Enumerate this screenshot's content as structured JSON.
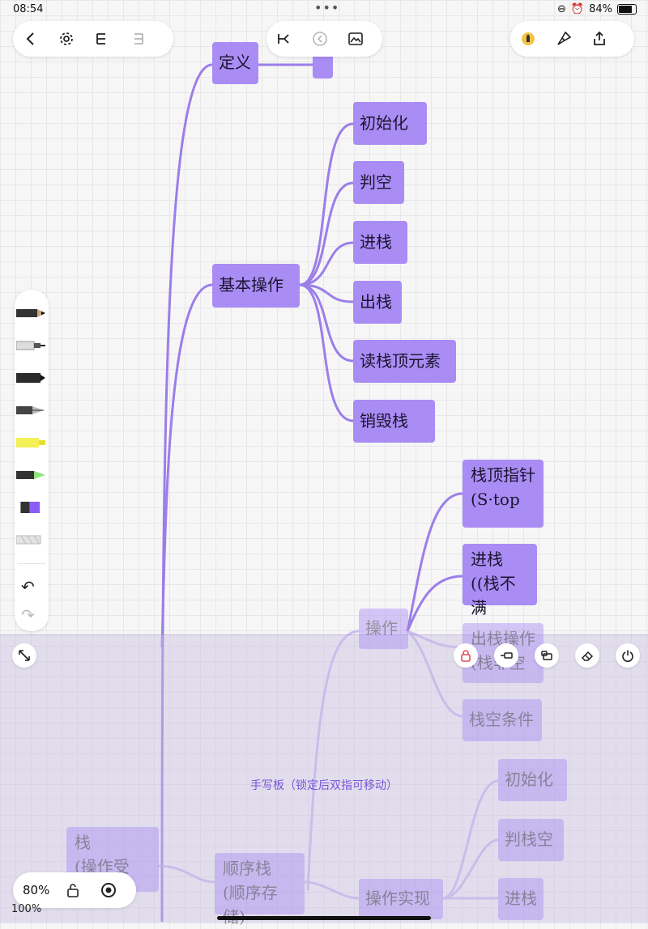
{
  "status": {
    "time": "08:54",
    "battery": "84%"
  },
  "toolbar": {
    "left_icons": [
      "back-icon",
      "settings-icon",
      "undo-layout-icon",
      "redo-layout-icon"
    ],
    "center_icons": [
      "branch-icon",
      "collapse-icon",
      "image-icon"
    ],
    "right_icons": [
      "pen-color-icon",
      "paint-brush-icon",
      "share-icon"
    ]
  },
  "mindmap": {
    "def": "定义",
    "basic_ops": "基本操作",
    "ops": [
      "初始化",
      "判空",
      "进栈",
      "出栈",
      "读栈顶元素",
      "销毁栈"
    ],
    "op_node": "操作",
    "top_ptr": [
      "栈顶指针",
      "(S·top"
    ],
    "push": [
      "进栈",
      "((栈不满"
    ],
    "pop": [
      "出栈操作",
      "(栈非空"
    ],
    "empty_cond": "栈空条件",
    "stack": [
      "栈",
      "(操作受限)"
    ],
    "seq_stack": [
      "顺序栈",
      "(顺序存储)"
    ],
    "impl": "操作实现",
    "impl_children": [
      "初始化",
      "判栈空",
      "进栈"
    ]
  },
  "tools": [
    "pencil",
    "fineliner",
    "marker",
    "fountain-pen",
    "highlighter",
    "brush",
    "eraser",
    "lasso"
  ],
  "panel": {
    "label": "手写板（锁定后双指可移动）",
    "buttons": [
      "lock-icon",
      "cursor-icon",
      "resize-icon",
      "eraser-icon",
      "power-icon"
    ]
  },
  "zoom": {
    "value": "80%",
    "base": "100%"
  },
  "colors": {
    "node": "#a98cf4",
    "edge": "#9b7ee8",
    "accent": "#7a55d8"
  }
}
